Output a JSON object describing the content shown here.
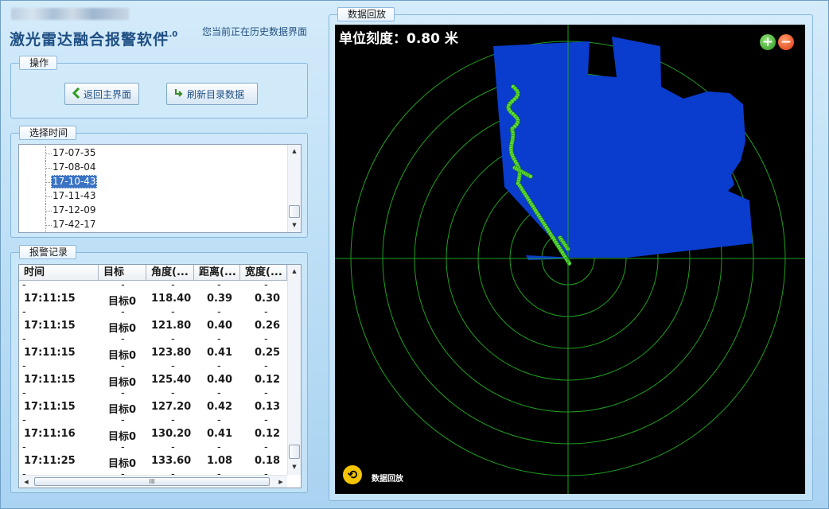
{
  "header": {
    "title": "激光雷达融合报警软件",
    "version": "v1.0",
    "status_note": "您当前正在历史数据界面"
  },
  "operations": {
    "legend": "操作",
    "back_button": "返回主界面",
    "refresh_button": "刷新目录数据"
  },
  "time_select": {
    "legend": "选择时间",
    "items": [
      "17-07-35",
      "17-08-04",
      "17-10-43",
      "17-11-43",
      "17-12-09",
      "17-42-17"
    ],
    "selected_index": 2
  },
  "alarm_log": {
    "legend": "报警记录",
    "columns": [
      "时间",
      "目标",
      "角度(...",
      "距离(...",
      "宽度(..."
    ],
    "blank_marker": "-",
    "rows": [
      {
        "time": "17:11:15",
        "target": "目标0",
        "angle": "118.40",
        "distance": "0.39",
        "width": "0.30"
      },
      {
        "time": "17:11:15",
        "target": "目标0",
        "angle": "121.80",
        "distance": "0.40",
        "width": "0.26"
      },
      {
        "time": "17:11:15",
        "target": "目标0",
        "angle": "123.80",
        "distance": "0.41",
        "width": "0.25"
      },
      {
        "time": "17:11:15",
        "target": "目标0",
        "angle": "125.40",
        "distance": "0.40",
        "width": "0.12"
      },
      {
        "time": "17:11:15",
        "target": "目标0",
        "angle": "127.20",
        "distance": "0.42",
        "width": "0.13"
      },
      {
        "time": "17:11:16",
        "target": "目标0",
        "angle": "130.20",
        "distance": "0.41",
        "width": "0.12"
      },
      {
        "time": "17:11:25",
        "target": "目标0",
        "angle": "133.60",
        "distance": "1.08",
        "width": "0.18"
      }
    ],
    "hscroll_grip": "III"
  },
  "replay": {
    "legend": "数据回放",
    "scale_text": "单位刻度：0.80 米",
    "zoom_in": "+",
    "zoom_out": "−",
    "replay_label": "数据回放",
    "replay_icon": "⟲",
    "colors": {
      "background": "#000000",
      "area_fill": "#0a3ccd",
      "grid": "#1fa01f",
      "targets": "#5ee03a"
    }
  },
  "icons": {
    "back": "arrow-left-icon",
    "refresh": "refresh-icon",
    "zoom_in": "zoom-in-icon",
    "zoom_out": "zoom-out-icon",
    "replay": "replay-icon"
  }
}
